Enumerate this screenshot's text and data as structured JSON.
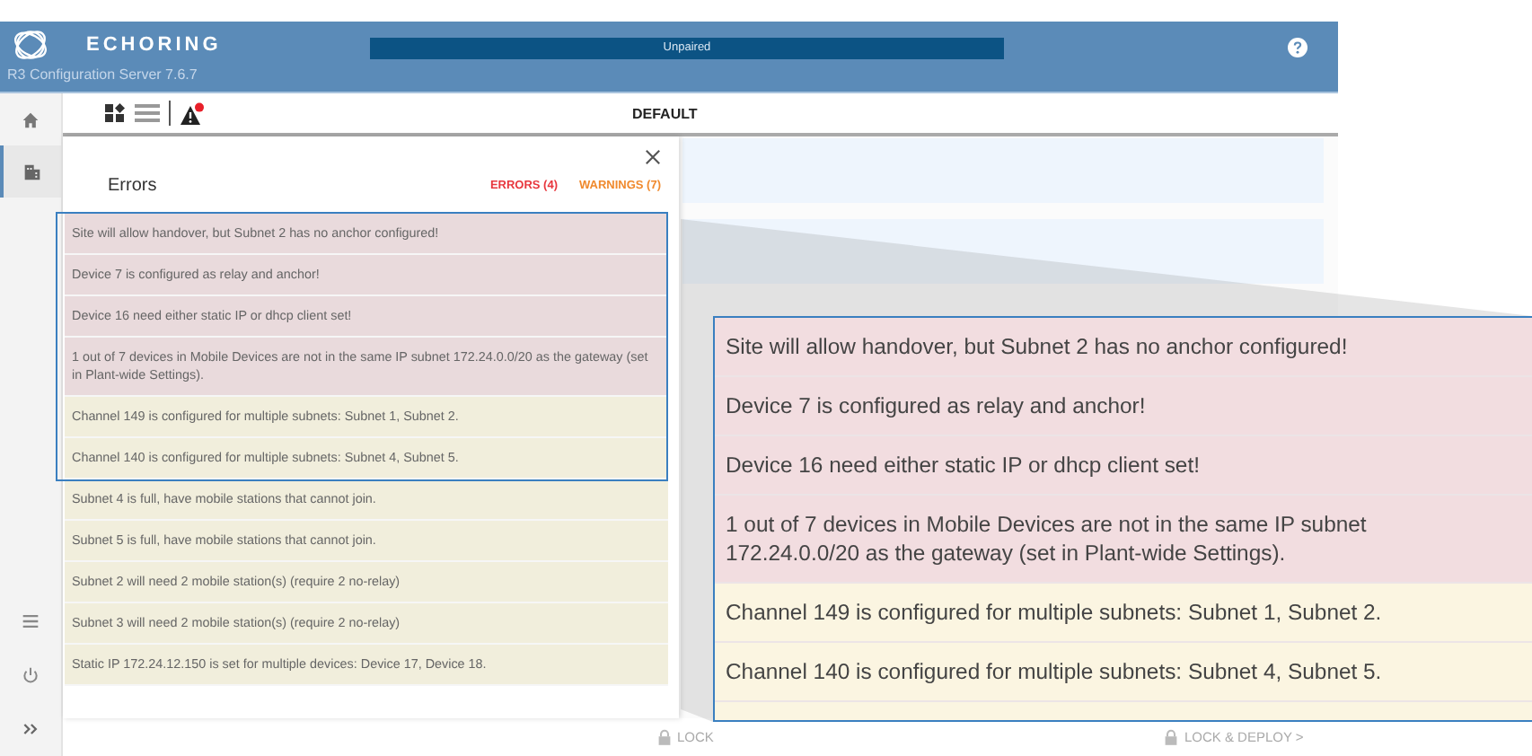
{
  "header": {
    "brand": "ECHORING",
    "subtitle": "R3 Configuration Server 7.6.7",
    "pairing": {
      "label": "Unpaired"
    }
  },
  "sidebar": {
    "items": [
      {
        "kind": "home",
        "selected": false
      },
      {
        "kind": "building",
        "selected": true
      }
    ],
    "bottom_items": [
      {
        "kind": "list"
      },
      {
        "kind": "power"
      },
      {
        "kind": "expand"
      }
    ]
  },
  "toolbar": {
    "title": "DEFAULT",
    "alert_badge": true
  },
  "errors_panel": {
    "title": "Errors",
    "errors_count": "ERRORS (4)",
    "warnings_count": "WARNINGS (7)",
    "messages": [
      {
        "kind": "error",
        "text": "Site will allow handover, but Subnet 2 has no anchor configured!"
      },
      {
        "kind": "error",
        "text": "Device 7 is configured as relay and anchor!"
      },
      {
        "kind": "error",
        "text": "Device 16 need either static IP or dhcp client set!"
      },
      {
        "kind": "error",
        "text": "1 out of 7 devices in Mobile Devices are not in the same IP subnet 172.24.0.0/20 as the gateway (set in Plant-wide Settings)."
      },
      {
        "kind": "warning",
        "text": "Channel 149 is configured for multiple subnets: Subnet 1, Subnet 2."
      },
      {
        "kind": "warning",
        "text": "Channel 140 is configured for multiple subnets: Subnet 4, Subnet 5."
      },
      {
        "kind": "warning",
        "text": "Subnet 4 is full, have mobile stations that cannot join."
      },
      {
        "kind": "warning",
        "text": "Subnet 5 is full, have mobile stations that cannot join."
      },
      {
        "kind": "warning",
        "text": "Subnet 2 will need 2 mobile station(s) (require 2 no-relay)"
      },
      {
        "kind": "warning",
        "text": "Subnet 3 will need 2 mobile station(s) (require 2 no-relay)"
      },
      {
        "kind": "warning",
        "text": "Static IP 172.24.12.150 is set for multiple devices: Device 17, Device 18."
      }
    ]
  },
  "footer": {
    "lock": "LOCK",
    "lock_deploy": "LOCK & DEPLOY >"
  },
  "magnifier": {
    "messages": [
      {
        "kind": "error",
        "text": "Site will allow handover, but Subnet 2 has no anchor configured!"
      },
      {
        "kind": "error",
        "text": "Device 7 is configured as relay and anchor!"
      },
      {
        "kind": "error",
        "text": "Device 16 need either static IP or dhcp client set!"
      },
      {
        "kind": "error",
        "text": "1 out of 7 devices in Mobile Devices are not in the same IP subnet 172.24.0.0/20 as the gateway (set in Plant-wide Settings)."
      },
      {
        "kind": "warning",
        "text": "Channel 149 is configured for multiple subnets: Subnet 1, Subnet 2."
      },
      {
        "kind": "warning",
        "text": "Channel 140 is configured for multiple subnets: Subnet 4, Subnet 5."
      },
      {
        "kind": "warning"
      }
    ]
  }
}
